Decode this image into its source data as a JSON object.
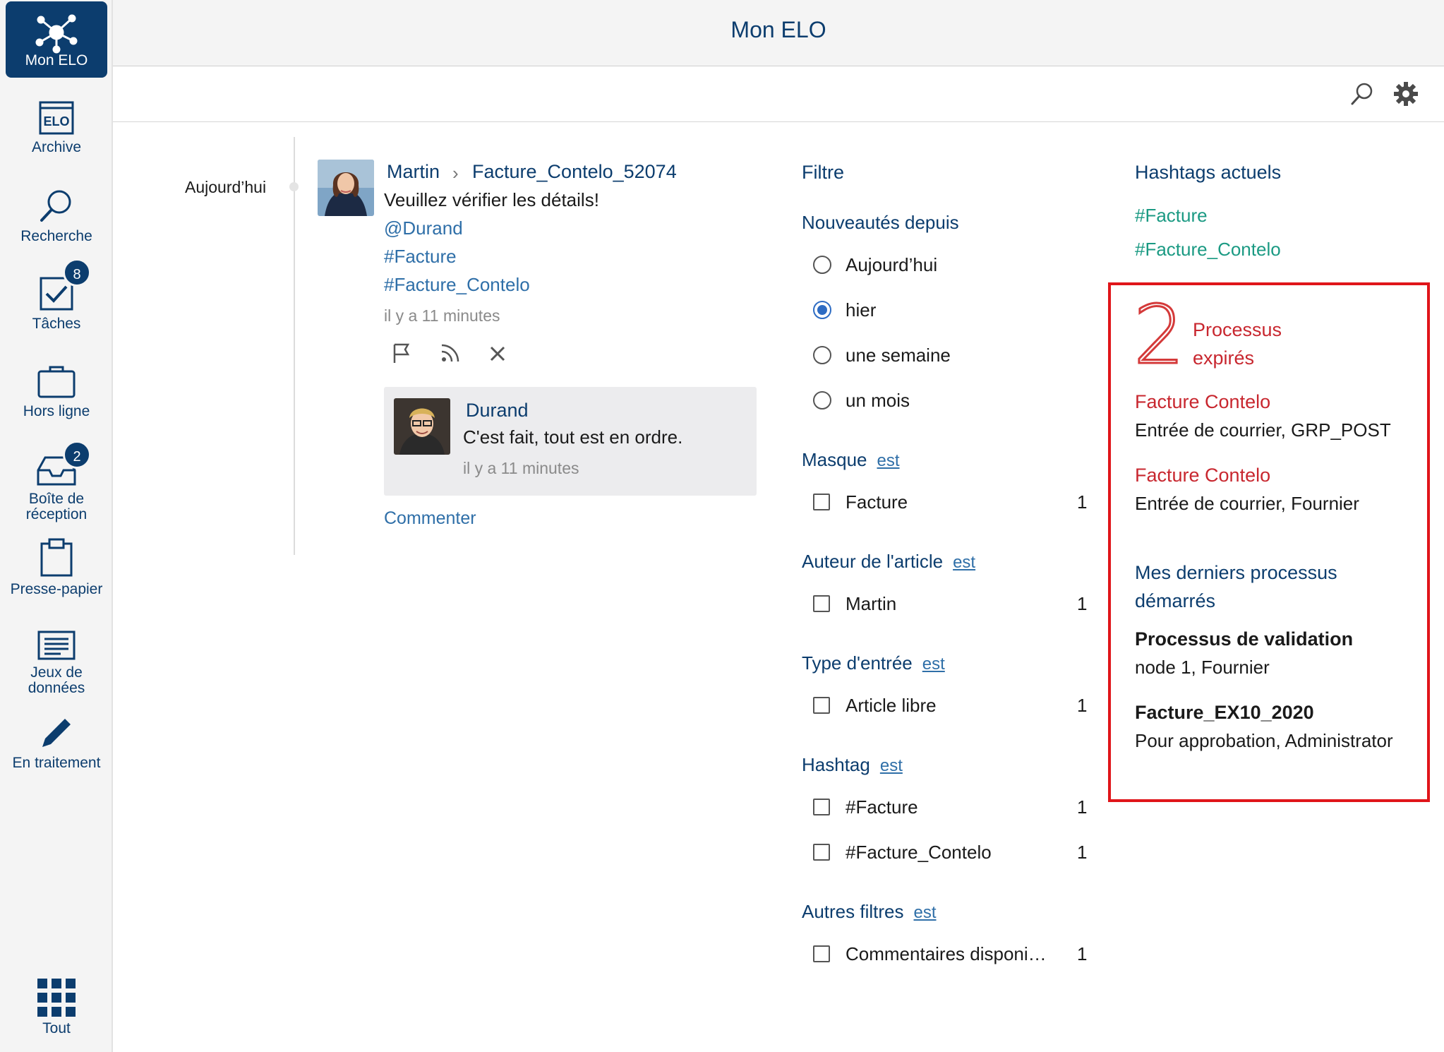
{
  "header": {
    "title": "Mon ELO"
  },
  "sidebar": {
    "items": [
      {
        "label": "Mon ELO",
        "icon": "network-icon",
        "active": true
      },
      {
        "label": "Archive",
        "icon": "archive-icon"
      },
      {
        "label": "Recherche",
        "icon": "search-icon"
      },
      {
        "label": "Tâches",
        "icon": "tasks-icon",
        "badge": "8"
      },
      {
        "label": "Hors ligne",
        "icon": "offline-icon"
      },
      {
        "label": "Boîte de",
        "label2": "réception",
        "icon": "inbox-icon",
        "badge": "2"
      },
      {
        "label": "Presse-papier",
        "icon": "clipboard-icon"
      },
      {
        "label": "Jeux de",
        "label2": "données",
        "icon": "datasets-icon"
      },
      {
        "label": "En traitement",
        "icon": "pencil-icon"
      },
      {
        "label": "Tout",
        "icon": "grid-icon"
      }
    ]
  },
  "feed": {
    "date": "Aujourd’hui",
    "post": {
      "author": "Martin",
      "document": "Facture_Contelo_52074",
      "text": "Veuillez vérifier les détails!",
      "mention": "@Durand",
      "hashtag1": "#Facture",
      "hashtag2": "#Facture_Contelo",
      "time": "il y a 11 minutes"
    },
    "reply": {
      "author": "Durand",
      "text": "C'est fait, tout est en ordre.",
      "time": "il y a 11 minutes"
    },
    "comment_label": "Commenter"
  },
  "filter": {
    "title": "Filtre",
    "since_label": "Nouveautés depuis",
    "since_options": [
      "Aujourd’hui",
      "hier",
      "une semaine",
      "un mois"
    ],
    "since_selected": "hier",
    "est": "est",
    "groups": [
      {
        "title": "Masque",
        "items": [
          {
            "label": "Facture",
            "count": "1"
          }
        ]
      },
      {
        "title": "Auteur de l'article",
        "items": [
          {
            "label": "Martin",
            "count": "1"
          }
        ]
      },
      {
        "title": "Type d'entrée",
        "items": [
          {
            "label": "Article libre",
            "count": "1"
          }
        ]
      },
      {
        "title": "Hashtag",
        "items": [
          {
            "label": "#Facture",
            "count": "1"
          },
          {
            "label": "#Facture_Contelo",
            "count": "1"
          }
        ]
      },
      {
        "title": "Autres filtres",
        "items": [
          {
            "label": "Commentaires disponi…",
            "count": "1"
          }
        ]
      }
    ]
  },
  "right": {
    "hashtags_title": "Hashtags actuels",
    "hashtags": [
      "#Facture",
      "#Facture_Contelo"
    ],
    "expired_count": "2",
    "expired_label1": "Processus",
    "expired_label2": "expirés",
    "expired": [
      {
        "title": "Facture Contelo",
        "sub": "Entrée de courrier, GRP_POST"
      },
      {
        "title": "Facture Contelo",
        "sub": "Entrée de courrier, Fournier"
      }
    ],
    "started_title1": "Mes derniers processus",
    "started_title2": "démarrés",
    "started": [
      {
        "title": "Processus de validation",
        "sub": "node 1, Fournier"
      },
      {
        "title": "Facture_EX10_2020",
        "sub": "Pour approbation, Administrator"
      }
    ]
  },
  "colors": {
    "primary": "#0c3d6e",
    "link": "#2f6fa8",
    "hashtag": "#1b9a83",
    "alert": "#c8272f",
    "highlight_border": "#e0151a"
  }
}
